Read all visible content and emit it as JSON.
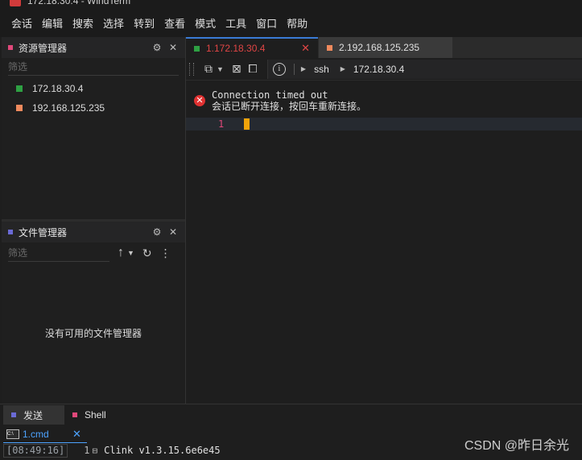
{
  "window": {
    "title": "172.18.30.4 - WindTerm"
  },
  "colors": {
    "accent": "#3a7bd5",
    "session_green": "#2ea043",
    "session_orange": "#f08a5d",
    "error_red": "#e03131",
    "cursor": "#f0a30a"
  },
  "menu": [
    "会话",
    "编辑",
    "搜索",
    "选择",
    "转到",
    "查看",
    "模式",
    "工具",
    "窗口",
    "帮助"
  ],
  "explorer": {
    "title": "资源管理器",
    "filter_placeholder": "筛选",
    "sessions": [
      {
        "label": "172.18.30.4",
        "color": "#2ea043"
      },
      {
        "label": "192.168.125.235",
        "color": "#f08a5d"
      }
    ]
  },
  "file_manager": {
    "title": "文件管理器",
    "filter_placeholder": "筛选",
    "empty_text": "没有可用的文件管理器"
  },
  "tabs": [
    {
      "label": "1.172.18.30.4",
      "color": "#2ea043",
      "active": true
    },
    {
      "label": "2.192.168.125.235",
      "color": "#f08a5d",
      "active": false
    }
  ],
  "address": {
    "protocol": "ssh",
    "host": "172.18.30.4"
  },
  "terminal": {
    "error_title": "Connection timed out",
    "error_detail": "会话已断开连接，按回车重新连接。",
    "line_number": "1"
  },
  "bottom": {
    "tabs": [
      {
        "label": "发送",
        "color": "#6b6bd6"
      },
      {
        "label": "Shell",
        "color": "#e0487a"
      }
    ],
    "subtab_label": "1.cmd",
    "log": {
      "time": "[08:49:16]",
      "line": "1",
      "text": "Clink v1.3.15.6e6e45"
    }
  },
  "watermark": "CSDN @昨日余光"
}
